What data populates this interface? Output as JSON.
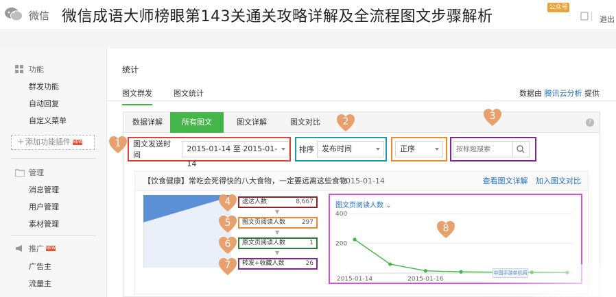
{
  "app": {
    "name": "微信",
    "logout": "退出",
    "badge": "公众号"
  },
  "overlay_title": "微信成语大师榜眼第143关通关攻略详解及全流程图文步骤解析",
  "sidebar": {
    "sections": [
      {
        "title": "功能",
        "items": [
          "群发功能",
          "自动回复",
          "自定义菜单"
        ],
        "add_plugin": "添加功能插件",
        "new_tag": "NEW"
      },
      {
        "title": "管理",
        "items": [
          "消息管理",
          "用户管理",
          "素材管理"
        ]
      },
      {
        "title": "推广",
        "items": [
          "广告主",
          "流量主"
        ],
        "new_tag": "NEW"
      }
    ]
  },
  "page": {
    "title": "统计",
    "tabs": [
      "图文群发",
      "图文统计"
    ],
    "provider_prefix": "数据由",
    "provider_link": "腾讯云分析",
    "provider_suffix": "提供"
  },
  "panel": {
    "subtabs": [
      "数据详解",
      "所有图文",
      "图文详解",
      "图文对比"
    ],
    "help": "?",
    "filters": {
      "date_label": "图文发送时间",
      "date_range": "2015-01-14 至 2015-01-14",
      "sort_label": "排序",
      "sort_by": "发布时间",
      "order": "正序",
      "search_placeholder": "按标题搜索"
    },
    "article": {
      "title": "【饮食健康】常吃会死得快的八大食物，一定要远离这些食物",
      "date": "2015-01-14",
      "link_view": "查看图文详解",
      "link_compare": "加入图文对比",
      "funnel": [
        {
          "label": "送达人数",
          "value": "8,667"
        },
        {
          "label": "图文页阅读人数",
          "value": "297"
        },
        {
          "label": "原文页阅读人数",
          "value": "1"
        },
        {
          "label": "转发+收藏人数",
          "value": "26"
        }
      ]
    }
  },
  "chart_data": {
    "type": "line",
    "title": "图文页阅读人数",
    "x": [
      "2015-01-14",
      "2015-01-15",
      "2015-01-16",
      "2015-01-17",
      "2015-01-18",
      "2015-01-19",
      "2015-01-20"
    ],
    "values": [
      225,
      60,
      15,
      8,
      6,
      5,
      4
    ],
    "xticks": [
      "2015-01-14",
      "2015-01-16"
    ],
    "yticks": [
      400,
      200
    ],
    "ylim": [
      0,
      450
    ],
    "color": "#44b549",
    "grid": true
  },
  "annotations": [
    "1",
    "2",
    "3",
    "4",
    "5",
    "6",
    "7",
    "8"
  ],
  "watermark": "中国手游单机网",
  "colors": {
    "green": "#44b549",
    "red": "#d9423a",
    "teal": "#1b9aa8",
    "orange": "#ea8a2e",
    "purple": "#7a2a8a",
    "magenta": "#d64ee0",
    "heart": "#e8a06d"
  }
}
